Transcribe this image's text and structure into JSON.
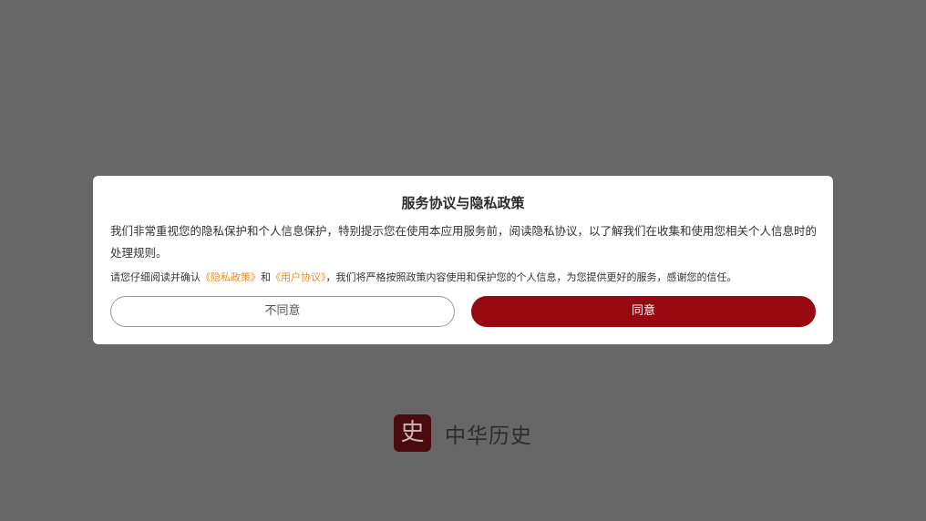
{
  "dialog": {
    "title": "服务协议与隐私政策",
    "body": "我们非常重视您的隐私保护和个人信息保护，特别提示您在使用本应用服务前，阅读隐私协议，以了解我们在收集和使用您相关个人信息时的处理规则。",
    "note_prefix": "请您仔细阅读并确认",
    "privacy_link": "《隐私政策》",
    "note_and": "和",
    "user_agreement_link": "《用户协议》",
    "note_suffix": "，我们将严格按照政策内容使用和保护您的个人信息，为您提供更好的服务，感谢您的信任。",
    "disagree_label": "不同意",
    "agree_label": "同意"
  },
  "brand": {
    "logo_char": "史",
    "name": "中华历史"
  },
  "colors": {
    "overlay": "#676767",
    "accent": "#980811",
    "link": "#f08a1c"
  }
}
